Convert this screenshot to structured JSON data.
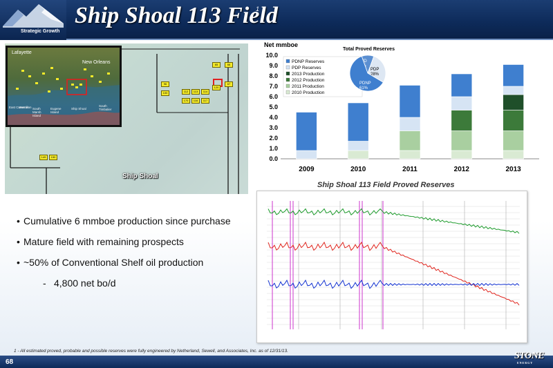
{
  "header": {
    "title": "Ship Shoal 113 Field",
    "title_footnote_marker": "1",
    "logo_caption": "Strategic Growth",
    "colors": {
      "bar": "#0d2a59",
      "accent": "#6f8fbf"
    }
  },
  "map": {
    "inset_labels": {
      "lafayette": "Lafayette",
      "new_orleans": "New Orleans",
      "ship_shoal": "Ship Shoal",
      "vermilion": "Vermilion",
      "eugene_island": "Eugene Island",
      "south_marsh_island": "South Marsh Island",
      "south_timbalier": "South Timbalier",
      "east_cameron": "East Cameron"
    },
    "main_label": "Ship Shoal",
    "colors": {
      "block": "#f4ea2a",
      "highlight": "#e02020"
    }
  },
  "chart_data": {
    "type": "bar",
    "title": "Total Proved Reserves",
    "ylabel": "Net mmboe",
    "ylim": [
      0,
      10
    ],
    "yticks": [
      "0.0",
      "1.0",
      "2.0",
      "3.0",
      "4.0",
      "5.0",
      "6.0",
      "7.0",
      "8.0",
      "9.0",
      "10.0"
    ],
    "categories": [
      "2009",
      "2010",
      "2011",
      "2012",
      "2013"
    ],
    "stacked": true,
    "series": [
      {
        "name": "2010 Production",
        "color": "#d9ead3",
        "values": [
          0.0,
          0.8,
          0.8,
          0.8,
          0.8
        ]
      },
      {
        "name": "2011 Production",
        "color": "#a9cfa0",
        "values": [
          0.0,
          0.0,
          1.9,
          1.9,
          1.9
        ]
      },
      {
        "name": "2012 Production",
        "color": "#3c7a3a",
        "values": [
          0.0,
          0.0,
          0.0,
          2.0,
          2.0
        ]
      },
      {
        "name": "2013 Production",
        "color": "#1f4f2a",
        "values": [
          0.0,
          0.0,
          0.0,
          0.0,
          1.5
        ]
      },
      {
        "name": "PDP Reserves",
        "color": "#d6e4f4",
        "values": [
          0.8,
          0.9,
          1.3,
          1.3,
          0.8
        ]
      },
      {
        "name": "PDNP Reserves",
        "color": "#3f7fcf",
        "values": [
          3.7,
          3.7,
          3.1,
          2.2,
          2.1
        ]
      }
    ],
    "legend": [
      "PDNP Reserves",
      "PDP Reserves",
      "2013 Production",
      "2012 Production",
      "2011 Production",
      "2010 Production"
    ],
    "legend_placement": "top-left",
    "inset_pie": {
      "slices": [
        {
          "name": "PUD",
          "value": 11,
          "label": "PUD 11%",
          "color": "#5b8fd1"
        },
        {
          "name": "PDP",
          "value": 28,
          "label": "PDP 28%",
          "color": "#dde7f3"
        },
        {
          "name": "PDNP",
          "value": 61,
          "label": "PDNP 61%",
          "color": "#3f7fcf"
        }
      ]
    },
    "caption": "Ship Shoal 113 Field Proved Reserves"
  },
  "bullets": [
    "Cumulative 6 mmboe production since purchase",
    "Mature field with remaining prospects",
    "~50% of Conventional Shelf oil production"
  ],
  "sub_bullets": [
    "4,800 net bo/d"
  ],
  "footnote": "1 - All estimated proved, probable and possible reserves were fully engineered by Netherland, Sewell, and Associates, Inc. as of 12/31/13.",
  "footer": {
    "page_number": "68",
    "logo_word": "STONE",
    "logo_sub": "ENERGY"
  }
}
